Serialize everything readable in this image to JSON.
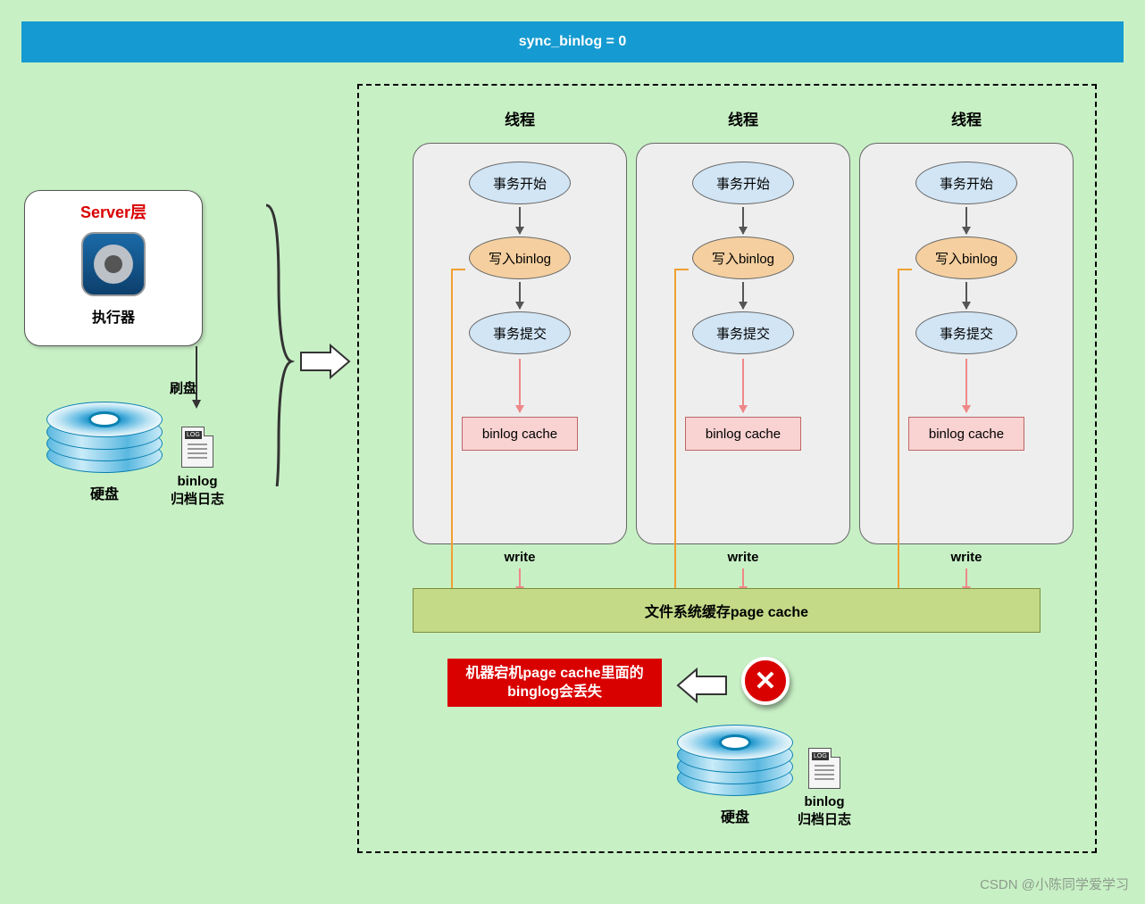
{
  "header": {
    "title": "sync_binlog = 0"
  },
  "server": {
    "title": "Server层",
    "executor": "执行器"
  },
  "diskLeft": {
    "label": "硬盘",
    "binlog_title": "binlog",
    "binlog_sub": "归档日志"
  },
  "flush_label": "刷盘",
  "threads": {
    "title": "线程",
    "step1": "事务开始",
    "step2": "写入binlog",
    "step3": "事务提交",
    "cache": "binlog cache",
    "write": "write"
  },
  "page_cache": "文件系统缓存page cache",
  "error": "机器宕机page cache里面的binglog会丢失",
  "diskBottom": {
    "label": "硬盘",
    "binlog_title": "binlog",
    "binlog_sub": "归档日志"
  },
  "watermark": "CSDN @小陈同学爱学习"
}
